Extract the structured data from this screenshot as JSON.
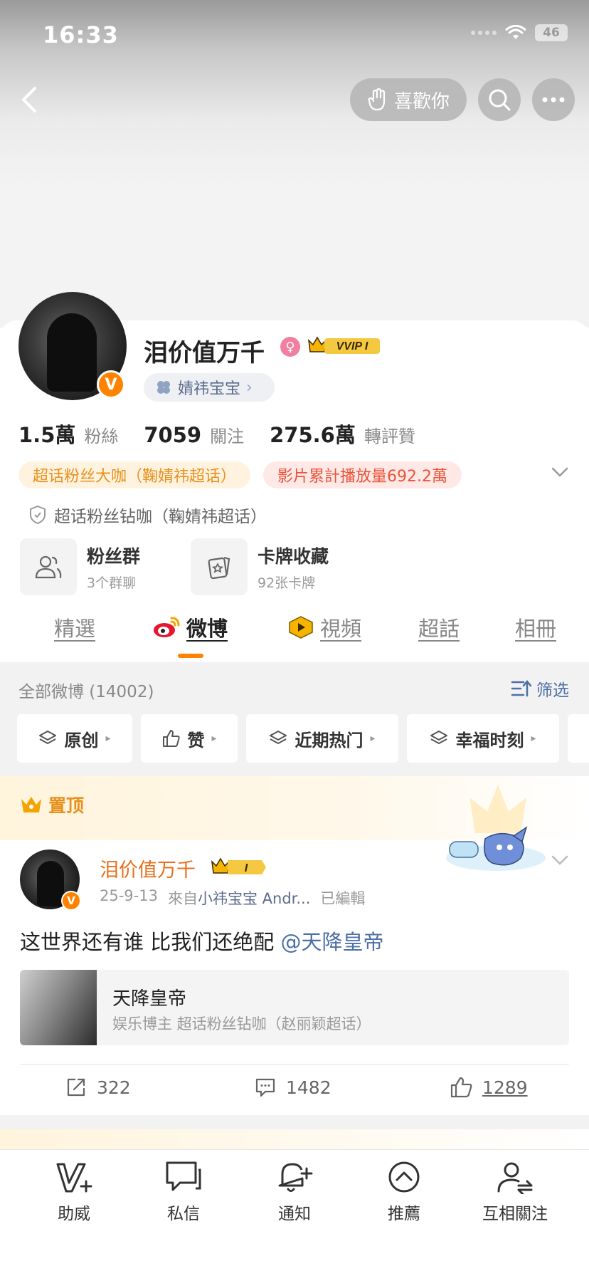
{
  "status_bar": {
    "time": "16:33",
    "battery": "46"
  },
  "header": {
    "like_label": "喜歡你"
  },
  "profile": {
    "name": "泪价值万千",
    "vip_label": "VVIP I",
    "group_label": "婧祎宝宝",
    "stats": [
      {
        "num": "1.5萬",
        "label": "粉絲"
      },
      {
        "num": "7059",
        "label": "關注"
      },
      {
        "num": "275.6萬",
        "label": "轉評贊"
      }
    ],
    "tags": [
      "超话粉丝大咖（鞠婧祎超话）",
      "影片累計播放量692.2萬"
    ],
    "diamond_line": "超话粉丝钻咖（鞠婧祎超话）",
    "features": [
      {
        "title": "粉丝群",
        "sub": "3个群聊"
      },
      {
        "title": "卡牌收藏",
        "sub": "92张卡牌"
      }
    ]
  },
  "tabs": [
    "精選",
    "微博",
    "視頻",
    "超話",
    "相冊"
  ],
  "filter": {
    "all_label": "全部微博 (14002)",
    "filter_label": "筛选",
    "chips": [
      "原创",
      "赞",
      "近期热门",
      "幸福时刻"
    ]
  },
  "pinned_label": "置顶",
  "post": {
    "author": "泪价值万千",
    "date": "25-9-13",
    "source_prefix": "來自",
    "source": "小祎宝宝 Andr...",
    "edited": "已編輯",
    "text": "这世界还有谁 比我们还绝配 ",
    "mention": "@天降皇帝",
    "card_title": "天降皇帝",
    "card_sub": "娱乐博主 超话粉丝钻咖（赵丽颖超话）",
    "reposts": "322",
    "comments": "1482",
    "likes": "1289"
  },
  "bottom_nav": [
    "助威",
    "私信",
    "通知",
    "推薦",
    "互相關注"
  ],
  "colors": {
    "accent": "#ff8200",
    "link": "#4d6fa6",
    "pinned": "#e8901b"
  }
}
